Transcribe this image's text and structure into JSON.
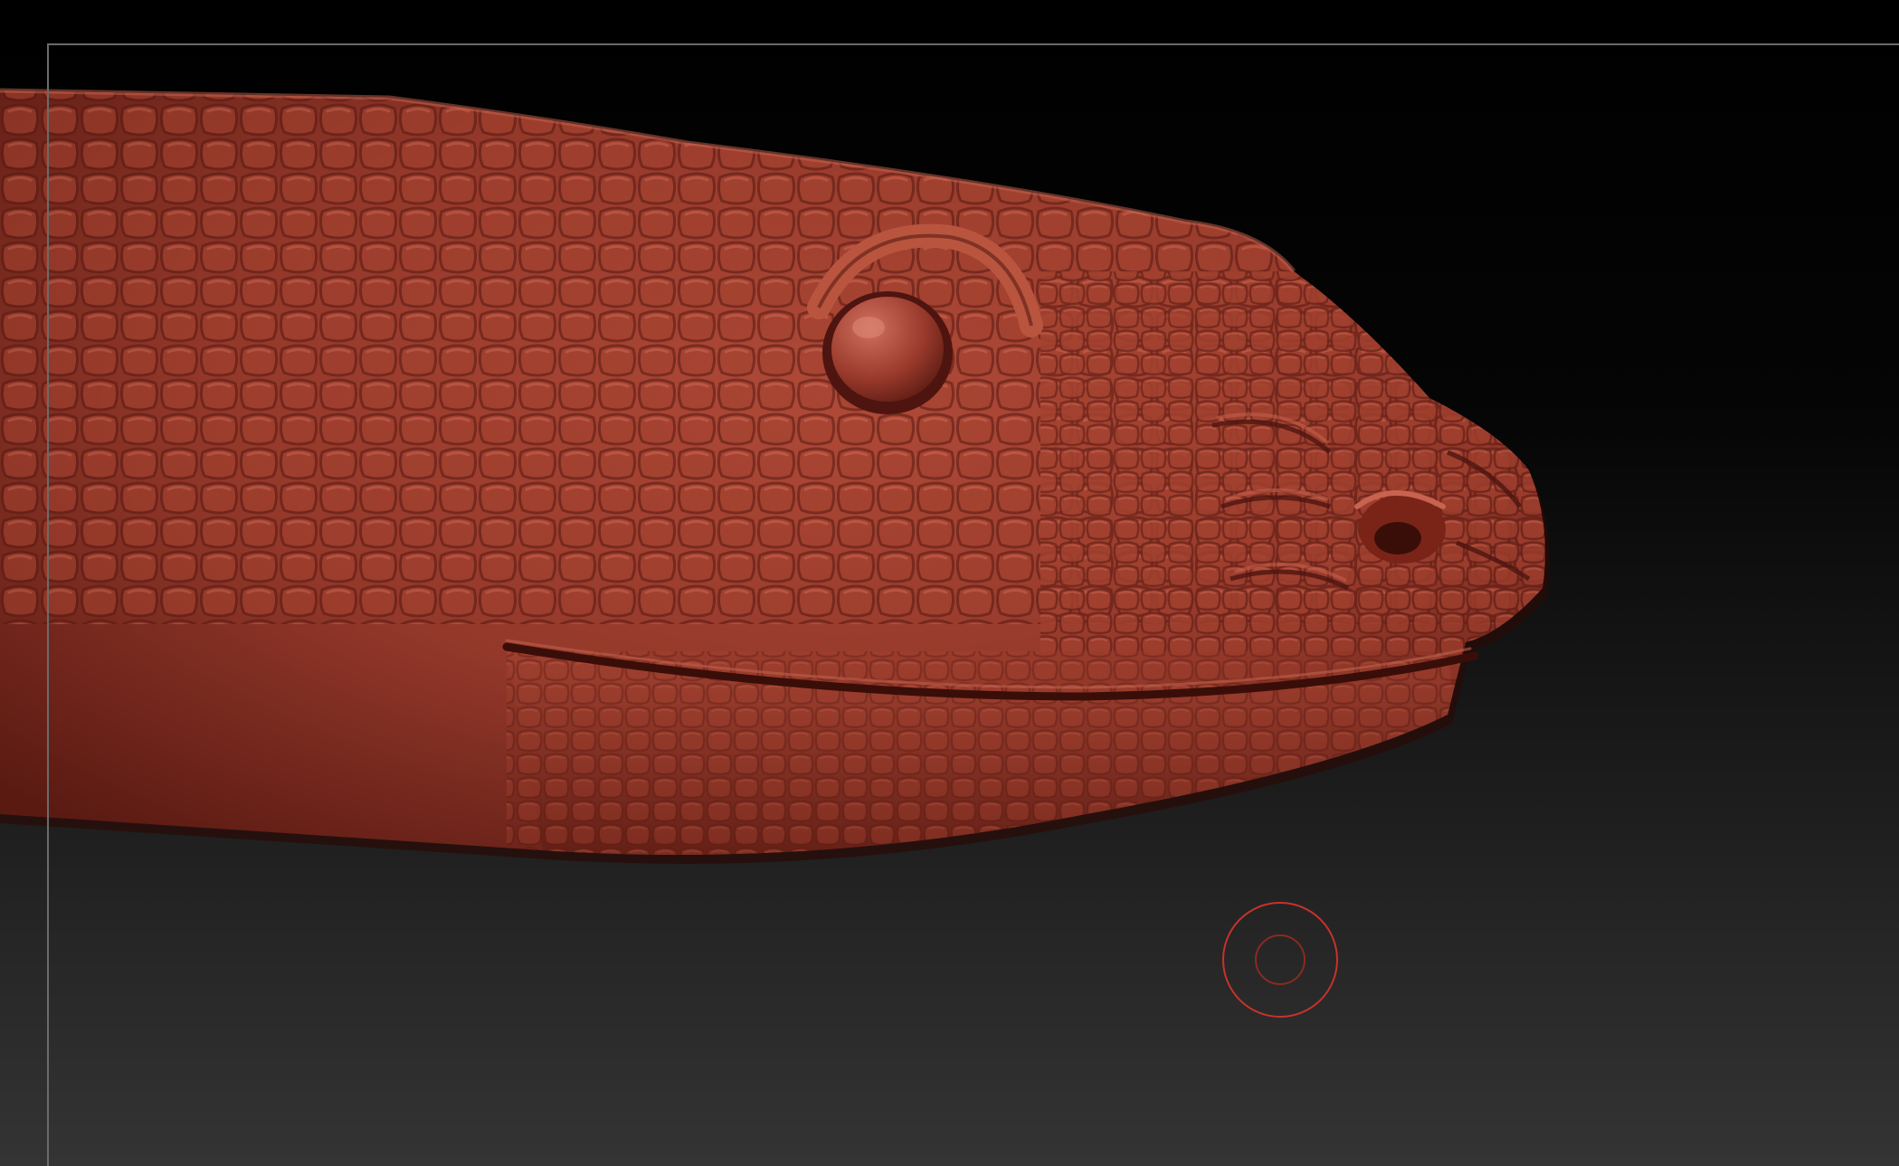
{
  "viewport": {
    "background_top": "#000000",
    "background_bottom": "#333333",
    "frame_color": "#6b6b6b"
  },
  "model": {
    "name": "snake-head-sculpt",
    "material_color": "#9a3a2c",
    "highlight_color": "#c65a47",
    "shadow_color": "#4e1510"
  },
  "brush": {
    "icon": "brush-cursor-icon",
    "color": "#c8322a"
  }
}
